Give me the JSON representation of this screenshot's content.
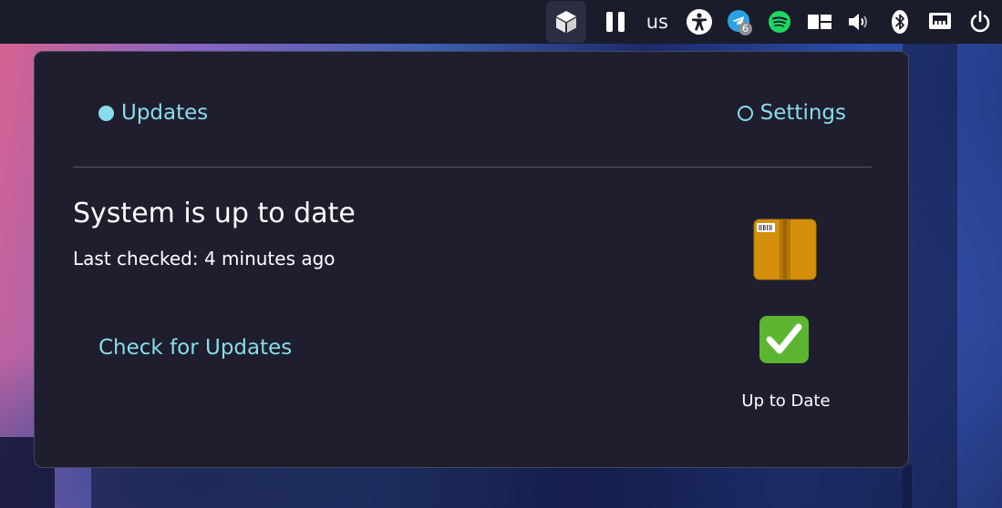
{
  "panel": {
    "keyboard_layout": "us",
    "telegram_badge": "6",
    "icons": [
      "package-icon",
      "pause-icon",
      "accessibility-icon",
      "telegram-icon",
      "spotify-icon",
      "window-layout-icon",
      "volume-icon",
      "bluetooth-icon",
      "network-icon",
      "power-icon"
    ]
  },
  "popup": {
    "tabs": {
      "updates": "Updates",
      "settings": "Settings"
    },
    "status_title": "System is up to date",
    "last_checked": "Last checked: 4 minutes ago",
    "check_button": "Check for Updates",
    "status_caption": "Up to Date"
  },
  "colors": {
    "accent": "#89dceb",
    "panel_bg": "#1a1b2b",
    "popup_bg": "#1e1e2e"
  }
}
